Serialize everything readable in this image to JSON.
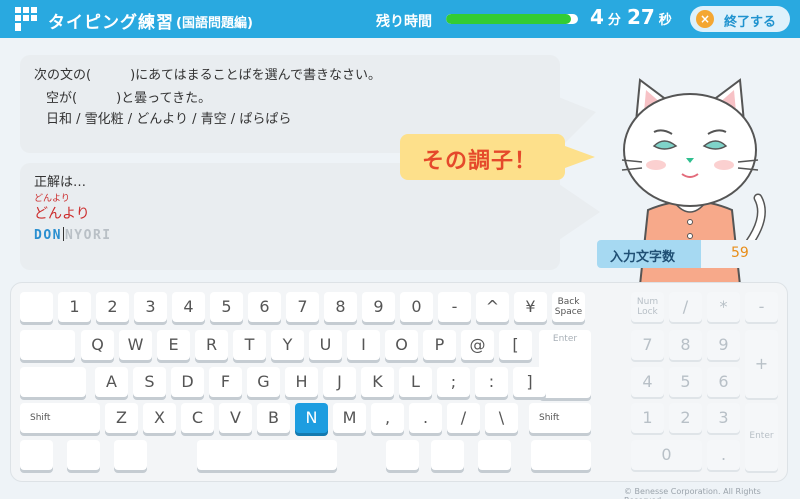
{
  "header": {
    "title": "タイピング練習",
    "subtitle": "(国語問題編)",
    "remaining_label": "残り時間",
    "progress": 0.95,
    "minutes": "4",
    "minutes_unit": "分",
    "seconds": "27",
    "seconds_unit": "秒",
    "end_label": "終了する",
    "end_icon": "×"
  },
  "question": {
    "line1": "次の文の(　　　)にあてはまることばを選んで書きなさい。",
    "line2": "空が(　　　)と曇ってきた。",
    "choices": "日和 / 雪化粧 / どんより / 青空 / ぱらぱら"
  },
  "answer": {
    "label": "正解は…",
    "ruby": "どんより",
    "text": "どんより",
    "typed": "DON",
    "remaining": "NYORI"
  },
  "praise": "その調子！",
  "counter": {
    "label": "入力文字数",
    "value": "59"
  },
  "keyboard": {
    "row1": [
      "",
      "1",
      "2",
      "3",
      "4",
      "5",
      "6",
      "7",
      "8",
      "9",
      "0",
      "-",
      "^",
      "¥",
      "Back Space"
    ],
    "row2": [
      "",
      "Q",
      "W",
      "E",
      "R",
      "T",
      "Y",
      "U",
      "I",
      "O",
      "P",
      "@",
      "["
    ],
    "enter": "Enter",
    "row3": [
      "",
      "A",
      "S",
      "D",
      "F",
      "G",
      "H",
      "J",
      "K",
      "L",
      ";",
      ":",
      "]"
    ],
    "row4": [
      "Shift",
      "Z",
      "X",
      "C",
      "V",
      "B",
      "N",
      "M",
      ",",
      ".",
      "/",
      "\\",
      "Shift"
    ],
    "active_key": "N",
    "numpad": [
      "Num Lock",
      "/",
      "*",
      "-",
      "7",
      "8",
      "9",
      "+",
      "4",
      "5",
      "6",
      "1",
      "2",
      "3",
      "Enter",
      "0",
      "."
    ]
  },
  "copyright": "© Benesse Corporation. All Rights Reserved."
}
